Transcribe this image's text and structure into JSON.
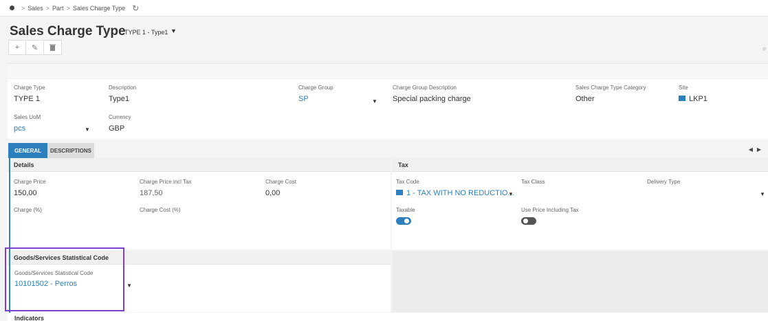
{
  "breadcrumb": {
    "items": [
      "Sales",
      "Part",
      "Sales Charge Type"
    ],
    "separator": ">"
  },
  "header": {
    "title": "Sales Charge Type",
    "subtitle": "TYPE 1 - Type1"
  },
  "toolbar": {
    "add_icon": "+",
    "edit_icon": "✎",
    "delete_icon": "🗑"
  },
  "fields": {
    "charge_type": {
      "label": "Charge Type",
      "value": "TYPE 1"
    },
    "description": {
      "label": "Description",
      "value": "Type1"
    },
    "charge_group": {
      "label": "Charge Group",
      "value": "SP"
    },
    "charge_group_description": {
      "label": "Charge Group Description",
      "value": "Special packing charge"
    },
    "sales_charge_type_category": {
      "label": "Sales Charge Type Category",
      "value": "Other"
    },
    "site": {
      "label": "Site",
      "value": "LKP1"
    },
    "sales_uom": {
      "label": "Sales UoM",
      "value": "pcs"
    },
    "currency": {
      "label": "Currency",
      "value": "GBP"
    }
  },
  "tabs": [
    {
      "label": "GENERAL",
      "active": true
    },
    {
      "label": "DESCRIPTIONS",
      "active": false
    }
  ],
  "details": {
    "title": "Details",
    "charge_price": {
      "label": "Charge Price",
      "value": "150,00"
    },
    "charge_price_incl_tax": {
      "label": "Charge Price incl Tax",
      "value": "187,50"
    },
    "charge_cost": {
      "label": "Charge Cost",
      "value": "0,00"
    },
    "charge_pct": {
      "label": "Charge (%)"
    },
    "charge_cost_pct": {
      "label": "Charge Cost (%)"
    }
  },
  "tax": {
    "title": "Tax",
    "tax_code": {
      "label": "Tax Code",
      "value": "1 - TAX WITH NO REDUCTIO..."
    },
    "tax_class": {
      "label": "Tax Class"
    },
    "delivery_type": {
      "label": "Delivery Type"
    },
    "taxable": {
      "label": "Taxable",
      "on": true
    },
    "use_price_including_tax": {
      "label": "Use Price Including Tax",
      "on": false
    }
  },
  "statistical": {
    "title": "Goods/Services Statistical Code",
    "label": "Goods/Services Statistical Code",
    "value": "10101502 - Perros"
  },
  "indicators": {
    "title": "Indicators"
  },
  "colors": {
    "accent": "#2e7fbd",
    "highlight": "#7b3fd1",
    "toggle_off": "#555555"
  },
  "icons": {
    "home": "home-icon",
    "refresh": "refresh-icon",
    "dropdown": "chevron-down-icon",
    "site": "site-icon",
    "tax_code": "tax-code-icon"
  }
}
